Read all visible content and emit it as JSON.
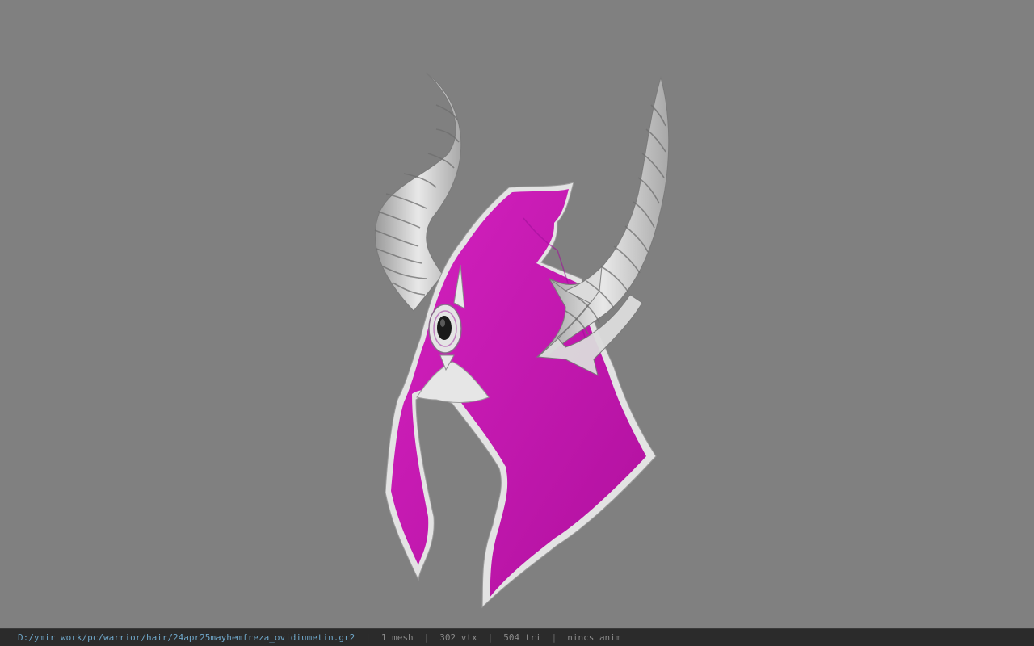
{
  "viewport": {
    "background_color": "#808080",
    "model": {
      "icon": "horned-hood-helmet-model",
      "cloth_color": "#c417b0",
      "trim_color": "#e6e6e6",
      "horn_color": "#cfcfcf",
      "gem_color": "#1a1a1a"
    }
  },
  "status_bar": {
    "file_path": "D:/ymir work/pc/warrior/hair/24apr25mayhemfreza_ovidiumetin.gr2",
    "separator": "|",
    "mesh_count": "1 mesh",
    "vertex_count": "302 vtx",
    "triangle_count": "504 tri",
    "anim_status": "nincs anim"
  }
}
